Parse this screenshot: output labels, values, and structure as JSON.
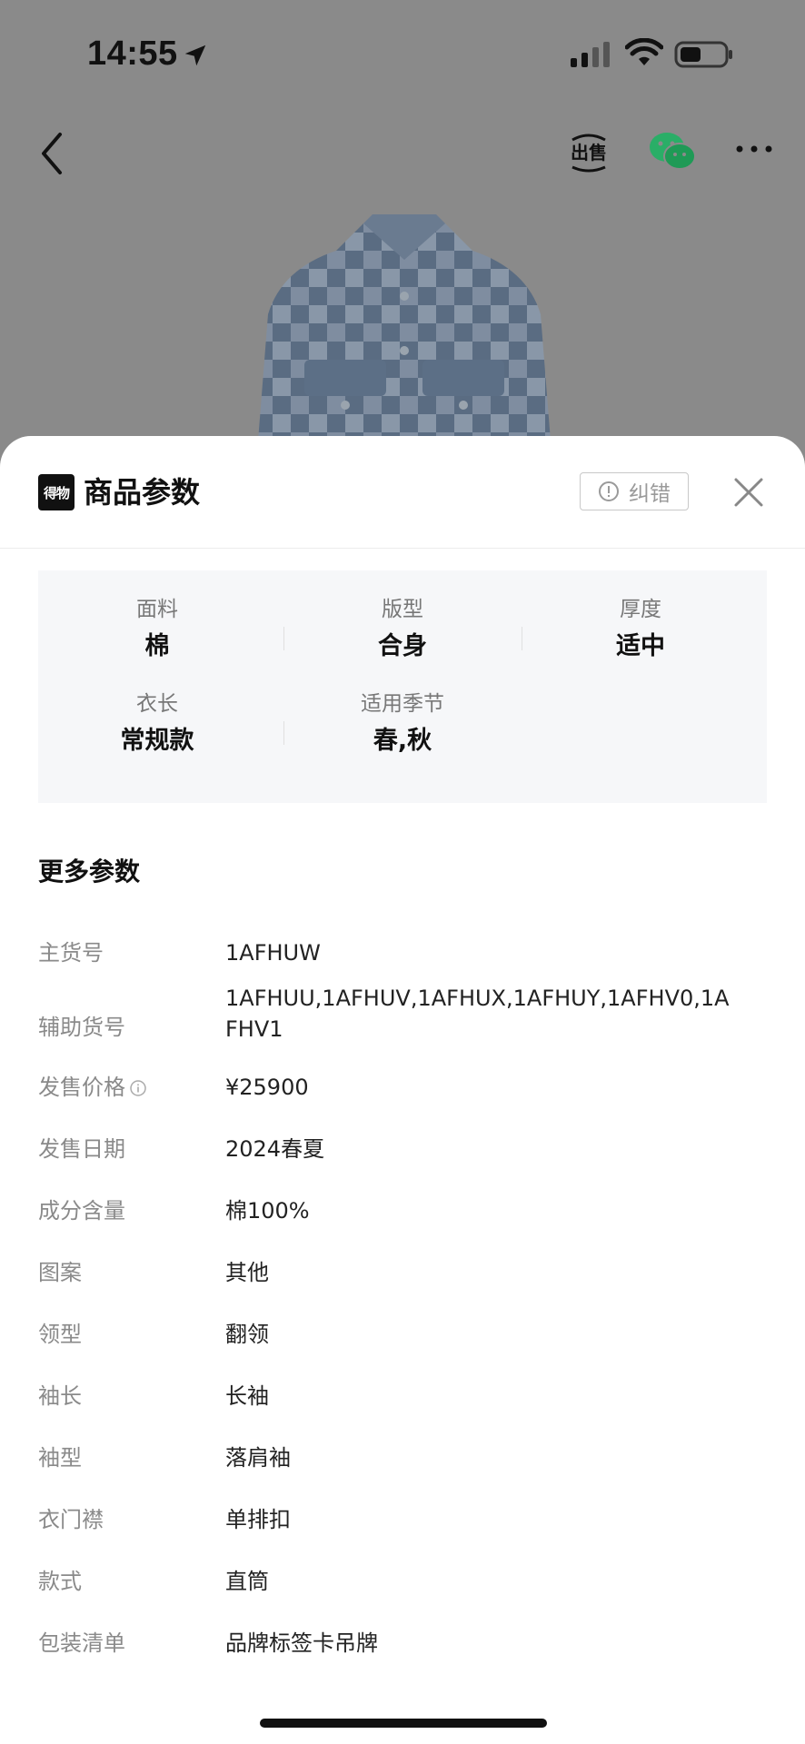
{
  "status_bar": {
    "time": "14:55"
  },
  "nav": {
    "sell_icon": "sell-icon",
    "share_icon": "wechat-icon",
    "more_icon": "more-icon"
  },
  "sheet": {
    "brand_logo_text": "得物",
    "title": "商品参数",
    "report_label": "纠错"
  },
  "key_params": [
    {
      "label": "面料",
      "value": "棉"
    },
    {
      "label": "版型",
      "value": "合身"
    },
    {
      "label": "厚度",
      "value": "适中"
    },
    {
      "label": "衣长",
      "value": "常规款"
    },
    {
      "label": "适用季节",
      "value": "春,秋"
    }
  ],
  "more_params": {
    "title": "更多参数",
    "rows": [
      {
        "label": "主货号",
        "value": "1AFHUW"
      },
      {
        "label": "辅助货号",
        "value": "1AFHUU,1AFHUV,1AFHUX,1AFHUY,1AFHV0,1AFHV1"
      },
      {
        "label": "发售价格",
        "value": "¥25900"
      },
      {
        "label": "发售日期",
        "value": "2024春夏"
      },
      {
        "label": "成分含量",
        "value": "棉100%"
      },
      {
        "label": "图案",
        "value": "其他"
      },
      {
        "label": "领型",
        "value": "翻领"
      },
      {
        "label": "袖长",
        "value": "长袖"
      },
      {
        "label": "袖型",
        "value": "落肩袖"
      },
      {
        "label": "衣门襟",
        "value": "单排扣"
      },
      {
        "label": "款式",
        "value": "直筒"
      },
      {
        "label": "包装清单",
        "value": "品牌标签卡吊牌"
      }
    ]
  },
  "colors": {
    "sheet_bg": "#ffffff",
    "key_params_bg": "#f6f7f9",
    "label_gray": "#8a8a8a",
    "wechat_green": "#2aae67"
  }
}
